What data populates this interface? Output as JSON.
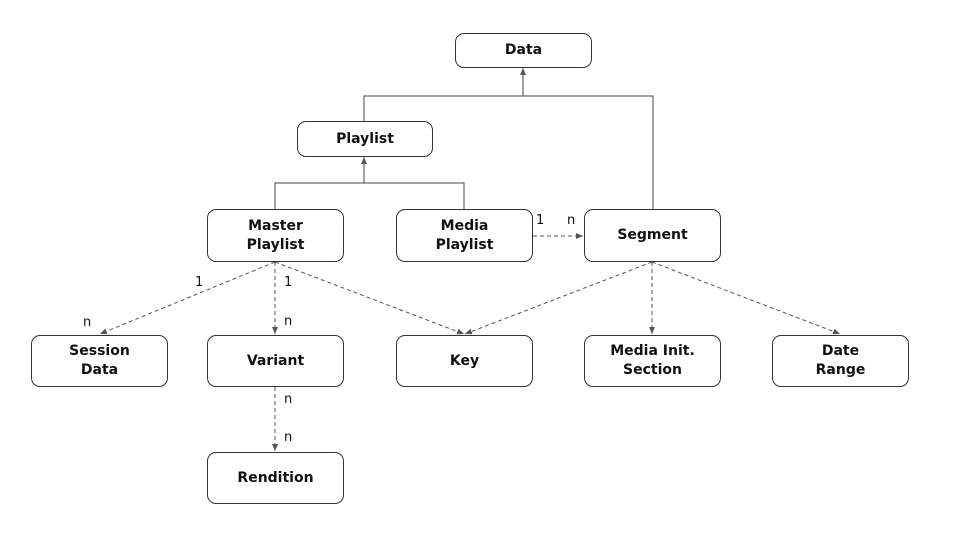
{
  "nodes": {
    "data": "Data",
    "playlist": "Playlist",
    "master_playlist": "Master\nPlaylist",
    "media_playlist": "Media\nPlaylist",
    "segment": "Segment",
    "session_data": "Session\nData",
    "variant": "Variant",
    "key": "Key",
    "media_init_section": "Media Init.\nSection",
    "date_range": "Date\nRange",
    "rendition": "Rendition"
  },
  "edges": [
    {
      "from": "playlist",
      "to": "data",
      "type": "inheritance"
    },
    {
      "from": "segment",
      "to": "data",
      "type": "inheritance"
    },
    {
      "from": "master_playlist",
      "to": "playlist",
      "type": "inheritance"
    },
    {
      "from": "media_playlist",
      "to": "playlist",
      "type": "inheritance"
    },
    {
      "from": "media_playlist",
      "to": "segment",
      "type": "association",
      "from_mult": "1",
      "to_mult": "n"
    },
    {
      "from": "master_playlist",
      "to": "session_data",
      "type": "association",
      "from_mult": "1",
      "to_mult": "n"
    },
    {
      "from": "master_playlist",
      "to": "variant",
      "type": "association",
      "from_mult": "1",
      "to_mult": "n"
    },
    {
      "from": "master_playlist",
      "to": "key",
      "type": "association"
    },
    {
      "from": "segment",
      "to": "key",
      "type": "association"
    },
    {
      "from": "segment",
      "to": "media_init_section",
      "type": "association"
    },
    {
      "from": "segment",
      "to": "date_range",
      "type": "association"
    },
    {
      "from": "variant",
      "to": "rendition",
      "type": "association",
      "from_mult": "n",
      "to_mult": "n"
    }
  ],
  "multiplicities": {
    "media_seg_1": "1",
    "media_seg_n": "n",
    "master_session_1": "1",
    "master_session_n": "n",
    "master_variant_1": "1",
    "master_variant_n": "n",
    "variant_rendition_n1": "n",
    "variant_rendition_n2": "n"
  }
}
